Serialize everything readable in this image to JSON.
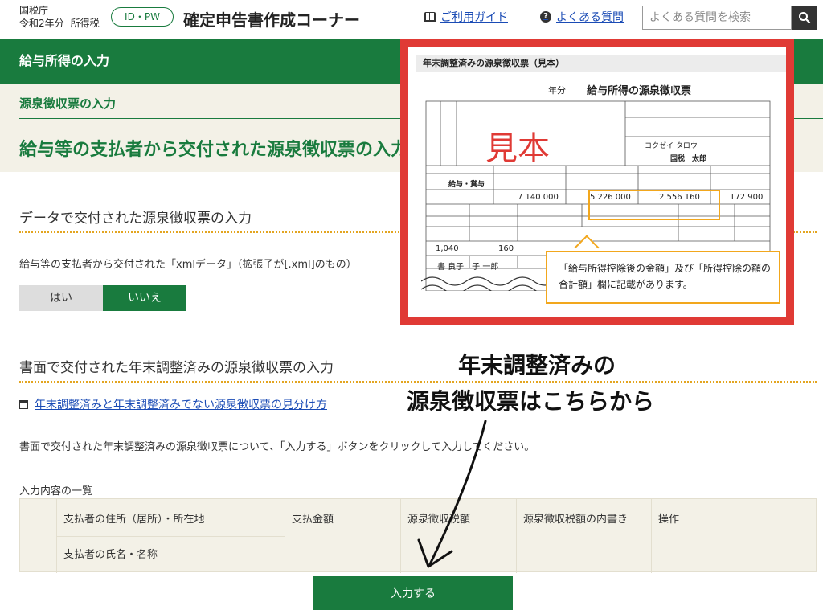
{
  "header": {
    "agency": "国税庁",
    "year": "令和2年分",
    "tax_type": "所得税",
    "auth_badge": "ID・PW",
    "app_title": "確定申告書作成コーナー",
    "guide_link": "ご利用ガイド",
    "faq_link": "よくある質問",
    "search_placeholder": "よくある質問を検索"
  },
  "page": {
    "section_bar": "給与所得の入力",
    "sub_title": "源泉徴収票の入力",
    "main_heading": "給与等の支払者から交付された源泉徴収票の入力"
  },
  "data_section": {
    "title": "データで交付された源泉徴収票の入力",
    "question": "給与等の支払者から交付された「xmlデータ」（拡張子が[.xml]のもの）",
    "options": [
      "はい",
      "いいえ"
    ],
    "selected": "いいえ"
  },
  "paper_section": {
    "title": "書面で交付された年末調整済みの源泉徴収票の入力",
    "link": "年末調整済みと年末調整済みでない源泉徴収票の見分け方",
    "instruction": "書面で交付された年末調整済みの源泉徴収票について、「入力する」ボタンをクリックして入力してください。"
  },
  "table": {
    "caption": "入力内容の一覧",
    "headers": {
      "payer_address": "支払者の住所（居所）・所在地",
      "payer_name": "支払者の氏名・名称",
      "amount": "支払金額",
      "withholding": "源泉徴収税額",
      "breakdown": "源泉徴収税額の内書き",
      "action": "操作"
    }
  },
  "submit_button": "入力する",
  "overlay": {
    "title": "年末調整済みの源泉徴収票（見本）",
    "slip_year": "年分",
    "slip_title": "給与所得の源泉徴収票",
    "stamp": "見本",
    "kana_name": "コクゼイ タロウ",
    "name": "国税　太郎",
    "row_label": "給与・賞与",
    "values": {
      "payment": "7 140 000",
      "after_deduction": "5 226 000",
      "deduction_total": "2 556 160",
      "tax": "172 900"
    },
    "lower_values": [
      "1,040",
      "160"
    ],
    "spouse": "書 良子　子 一郎",
    "callout": "「給与所得控除後の金額」及び「所得控除の額の合計額」欄に記載があります。"
  },
  "annotation": {
    "line1": "年末調整済みの",
    "line2": "源泉徴収票はこちらから"
  }
}
